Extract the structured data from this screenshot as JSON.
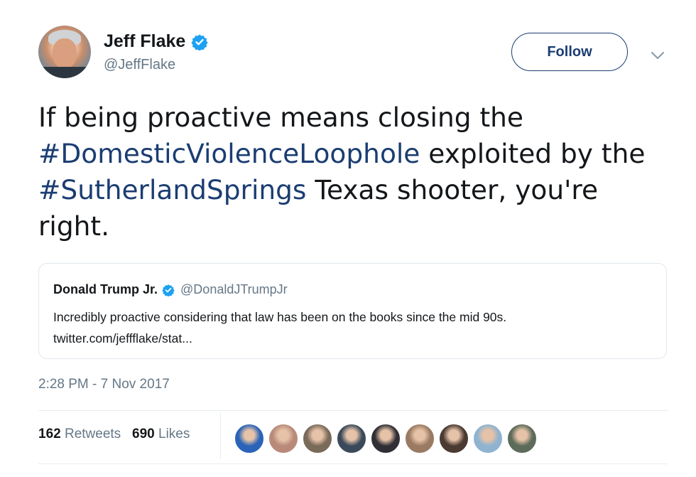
{
  "author": {
    "name": "Jeff Flake",
    "handle": "@JeffFlake",
    "verified_icon": "verified-badge-icon",
    "avatar_icon": "profile-photo"
  },
  "header": {
    "follow_label": "Follow",
    "menu_icon": "chevron-down-icon"
  },
  "tweet": {
    "text_part1": "If being proactive means closing the ",
    "hashtag1": "#DomesticViolenceLoophole",
    "text_part2": " exploited by the ",
    "hashtag2": "#SutherlandSprings",
    "text_part3": " Texas shooter, you're right."
  },
  "quoted_tweet": {
    "name": "Donald Trump Jr.",
    "handle": "@DonaldJTrumpJr",
    "text": "Incredibly proactive considering that law has been on the books since the mid 90s.",
    "link": "twitter.com/jeffflake/stat..."
  },
  "timestamp": "2:28 PM - 7 Nov 2017",
  "stats": {
    "retweets_count": "162",
    "retweets_label": "Retweets",
    "likes_count": "690",
    "likes_label": "Likes"
  },
  "likers_colors": [
    "#2a63b8",
    "#b98a7a",
    "#7a6a5a",
    "#3b4a5a",
    "#2f2f35",
    "#9a7a62",
    "#4a3a32",
    "#8fb3d0",
    "#5d6b5a"
  ],
  "colors": {
    "link": "#1b3d72",
    "secondary_text": "#657786",
    "verified": "#1da1f2"
  }
}
